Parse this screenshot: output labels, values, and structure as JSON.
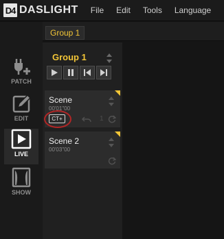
{
  "app": {
    "logo_mark": "D4",
    "logo_name": "DASLIGHT",
    "menu": [
      "File",
      "Edit",
      "Tools",
      "Language"
    ]
  },
  "sidebar": {
    "items": [
      {
        "label": "PATCH",
        "icon": "patch-icon",
        "active": false
      },
      {
        "label": "EDIT",
        "icon": "edit-icon",
        "active": false
      },
      {
        "label": "LIVE",
        "icon": "live-play-icon",
        "active": true
      },
      {
        "label": "SHOW",
        "icon": "show-curtain-icon",
        "active": false
      }
    ]
  },
  "tabs": [
    {
      "label": "Group 1",
      "active": true
    }
  ],
  "group": {
    "title": "Group 1",
    "transport": [
      "play-icon",
      "pause-icon",
      "previous-icon",
      "next-icon"
    ]
  },
  "scenes": [
    {
      "name": "Scene",
      "time": "00'01\"00",
      "badge": "CT+",
      "count": "1",
      "highlighted": true
    },
    {
      "name": "Scene 2",
      "time": "00'03\"00"
    }
  ],
  "colors": {
    "accent": "#f2c537",
    "highlight_ring": "#b22626",
    "background": "#151515"
  }
}
